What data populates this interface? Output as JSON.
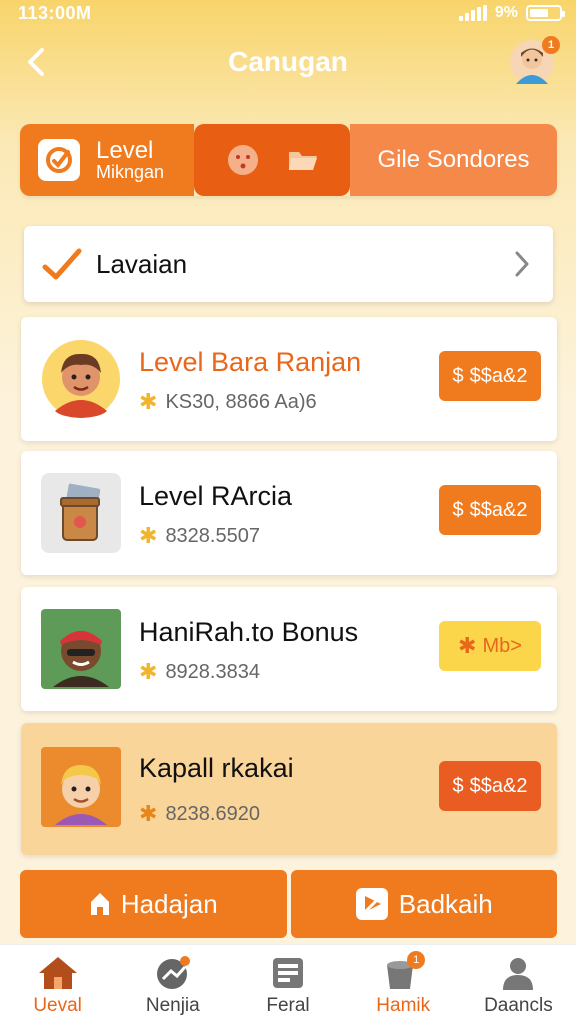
{
  "status_bar": {
    "time": "113:00M",
    "battery": "9%"
  },
  "header": {
    "title": "Canugan",
    "avatar_badge": "1"
  },
  "segments": {
    "level_title": "Level",
    "level_sub": "Mikngan",
    "right_label": "Gile Sondores"
  },
  "section": {
    "label": "Lavaian"
  },
  "items": [
    {
      "title": "Level Bara Ranjan",
      "meta": "KS30, 8866 Aa)6",
      "cta": "$$a&2"
    },
    {
      "title": "Level RArcia",
      "meta": "8328.5507",
      "cta": "$$a&2"
    },
    {
      "title": "HaniRah.to Bonus",
      "meta": "8928.3834",
      "cta": "Mb>"
    },
    {
      "title": "Kapall rkakai",
      "meta": "8238.6920",
      "cta": "$$a&2"
    }
  ],
  "actions": {
    "left": "Hadajan",
    "right": "Badkaih"
  },
  "tabs": [
    {
      "label": "Ueval"
    },
    {
      "label": "Nenjia"
    },
    {
      "label": "Feral"
    },
    {
      "label": "Hamik",
      "badge": "1"
    },
    {
      "label": "Daancls"
    }
  ],
  "colors": {
    "accent": "#f07b1f",
    "accent_dark": "#e85e12",
    "highlight_card": "#fad59a",
    "star": "#f1b52b"
  }
}
